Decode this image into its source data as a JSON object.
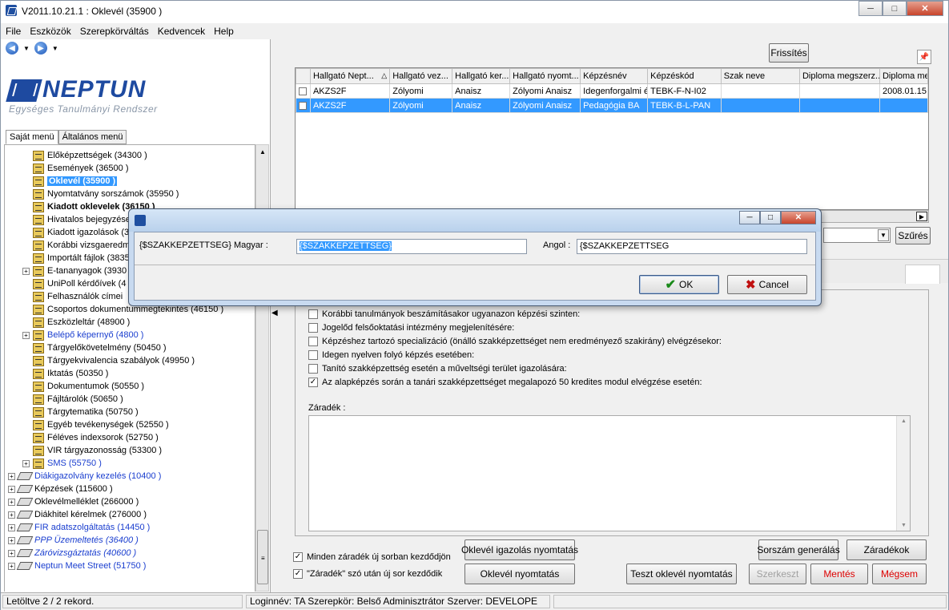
{
  "window": {
    "title": "V2011.10.21.1 : Oklevél (35900  )"
  },
  "menu": [
    "File",
    "Eszközök",
    "Szerepkörváltás",
    "Kedvencek",
    "Help"
  ],
  "logo": {
    "name": "NEPTUN",
    "subtitle": "Egységes Tanulmányi Rendszer"
  },
  "tabs": [
    "Saját menü",
    "Általános menü"
  ],
  "tree": [
    {
      "label": "Előképzettségek (34300  )",
      "style": "normal",
      "kind": "item"
    },
    {
      "label": "Események (36500  )",
      "style": "normal",
      "kind": "item"
    },
    {
      "label": "Oklevél (35900  )",
      "style": "selected",
      "kind": "item"
    },
    {
      "label": "Nyomtatvány sorszámok (35950  )",
      "style": "normal",
      "kind": "item"
    },
    {
      "label": "Kiadott oklevelek (36150  )",
      "style": "bold",
      "kind": "item"
    },
    {
      "label": "Hivatalos bejegyzések",
      "style": "normal",
      "kind": "item"
    },
    {
      "label": "Kiadott igazolások (3",
      "style": "normal",
      "kind": "item"
    },
    {
      "label": "Korábbi vizsgaeredm",
      "style": "normal",
      "kind": "item"
    },
    {
      "label": "Importált fájlok (3835",
      "style": "normal",
      "kind": "item"
    },
    {
      "label": "E-tananyagok (3930",
      "style": "normal",
      "kind": "item",
      "expander": true
    },
    {
      "label": "UniPoll kérdőívek (4",
      "style": "normal",
      "kind": "item"
    },
    {
      "label": "Felhasználók címei",
      "style": "normal",
      "kind": "item"
    },
    {
      "label": "Csoportos dokumentummegtekintés (46150  )",
      "style": "normal",
      "kind": "item"
    },
    {
      "label": "Eszközleltár (48900  )",
      "style": "normal",
      "kind": "item"
    },
    {
      "label": "Belépő képernyő (4800  )",
      "style": "blue",
      "kind": "item",
      "expander": true
    },
    {
      "label": "Tárgyelőkövetelmény (50450  )",
      "style": "normal",
      "kind": "item"
    },
    {
      "label": "Tárgyekvivalencia szabályok (49950  )",
      "style": "normal",
      "kind": "item"
    },
    {
      "label": "Iktatás (50350  )",
      "style": "normal",
      "kind": "item"
    },
    {
      "label": "Dokumentumok (50550  )",
      "style": "normal",
      "kind": "item"
    },
    {
      "label": "Fájltárolók (50650  )",
      "style": "normal",
      "kind": "item"
    },
    {
      "label": "Tárgytematika (50750  )",
      "style": "normal",
      "kind": "item"
    },
    {
      "label": "Egyéb tevékenységek (52550  )",
      "style": "normal",
      "kind": "item"
    },
    {
      "label": "Féléves indexsorok (52750  )",
      "style": "normal",
      "kind": "item"
    },
    {
      "label": "VIR tárgyazonosság (53300  )",
      "style": "normal",
      "kind": "item"
    },
    {
      "label": "SMS (55750  )",
      "style": "blue",
      "kind": "item",
      "expander": true
    },
    {
      "label": "Diákigazolvány kezelés (10400  )",
      "style": "blue",
      "kind": "folder"
    },
    {
      "label": "Képzések (115600  )",
      "style": "normal",
      "kind": "folder"
    },
    {
      "label": "Oklevélmelléklet (266000  )",
      "style": "normal",
      "kind": "folder"
    },
    {
      "label": "Diákhitel kérelmek (276000  )",
      "style": "normal",
      "kind": "folder"
    },
    {
      "label": "FIR adatszolgáltatás (14450  )",
      "style": "blue",
      "kind": "folder"
    },
    {
      "label": "PPP Üzemeltetés (36400  )",
      "style": "blue-italic",
      "kind": "folder"
    },
    {
      "label": "Záróvizsgáztatás (40600  )",
      "style": "blue-italic",
      "kind": "folder"
    },
    {
      "label": "Neptun Meet Street (51750  )",
      "style": "blue",
      "kind": "folder"
    }
  ],
  "grid": {
    "refresh_label": "Frissítés",
    "columns": [
      "",
      "Hallgató Nept...",
      "Hallgató vez...",
      "Hallgató ker...",
      "Hallgató nyomt...",
      "Képzésnév",
      "Képzéskód",
      "Szak neve",
      "Diploma megszerz...",
      "Diploma me"
    ],
    "rows": [
      [
        "",
        "AKZS2F",
        "Zólyomi",
        "Anaisz",
        "Zólyomi Anaisz",
        "Idegenforgalmi és",
        "TEBK-F-N-I02",
        "",
        "",
        "2008.01.15"
      ],
      [
        "",
        "AKZS2F",
        "Zólyomi",
        "Anaisz",
        "Zólyomi Anaisz",
        "Pedagógia BA",
        "TEBK-B-L-PAN",
        "",
        "",
        ""
      ]
    ],
    "selected_row": 1,
    "sort_glyph": "△"
  },
  "filter_label": "Szűrés",
  "checkboxes": [
    {
      "label": "Korábbi tanulmányok beszámításakor ugyanazon képzési szinten:",
      "checked": false
    },
    {
      "label": "Jogelőd felsőoktatási intézmény megjelenítésére:",
      "checked": false
    },
    {
      "label": "Képzéshez tartozó specializáció (önálló szakképzettséget nem eredményező szakirány) elvégzésekor:",
      "checked": false
    },
    {
      "label": "Idegen nyelven folyó képzés esetében:",
      "checked": false
    },
    {
      "label": "Tanító szakképzettség esetén a műveltségi terület igazolására:",
      "checked": false
    },
    {
      "label": "Az alapképzés során a tanári szakképzettséget megalapozó 50 kredites modul elvégzése esetén:",
      "checked": true
    }
  ],
  "zaradek_label": "Záradék :",
  "bottom_checkboxes": [
    {
      "label": "Minden záradék új sorban kezdődjön",
      "checked": true
    },
    {
      "label": "\"Záradék\" szó után új sor kezdődik",
      "checked": true
    }
  ],
  "buttons": {
    "oklevel_igazolas": "Oklevél igazolás nyomtatás",
    "oklevel_nyomtatas": "Oklevél nyomtatás",
    "teszt_oklevel": "Teszt oklevél nyomtatás",
    "sorszam": "Sorszám generálás",
    "zaradekok": "Záradékok",
    "szerkeszt": "Szerkeszt",
    "mentes": "Mentés",
    "megsem": "Mégsem"
  },
  "statusbar": {
    "records": "Letöltve 2 / 2 rekord.",
    "login": "Loginnév: TA  Szerepkör: Belső Adminisztrátor  Szerver: DEVELOPE"
  },
  "dialog": {
    "label_magyar": "{$SZAKKEPZETTSEG}  Magyar :",
    "value_magyar": "{$SZAKKEPZETTSEG}",
    "label_angol": "Angol :",
    "value_angol": "{$SZAKKEPZETTSEG",
    "ok": "OK",
    "cancel": "Cancel"
  },
  "colors": {
    "selection": "#3399ff",
    "link_blue": "#1a3ecf",
    "brand": "#1e4aa0",
    "danger": "#dd0000"
  }
}
